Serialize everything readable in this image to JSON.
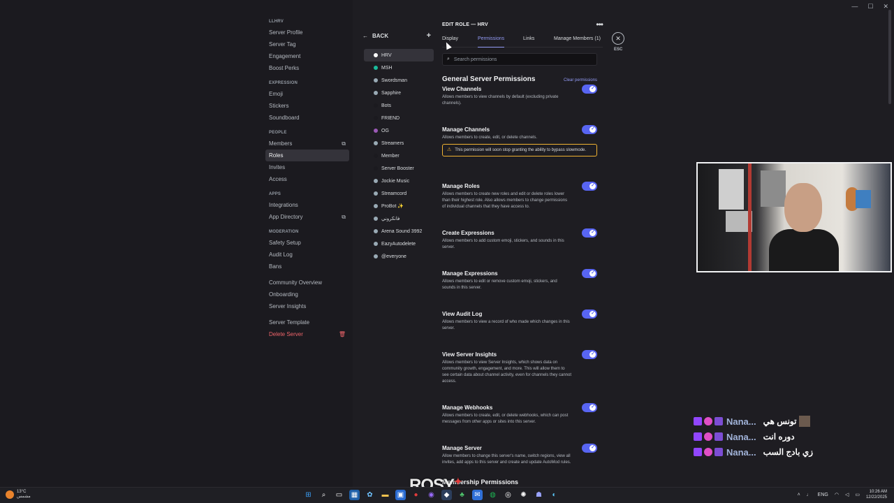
{
  "window": {
    "minimize": "—",
    "maximize": "☐",
    "close": "✕"
  },
  "nav": {
    "server_name": "LLHRV",
    "top_items": [
      "Server Profile",
      "Server Tag",
      "Engagement",
      "Boost Perks"
    ],
    "expression_header": "EXPRESSION",
    "expression_items": [
      "Emoji",
      "Stickers",
      "Soundboard"
    ],
    "people_header": "PEOPLE",
    "people_items": [
      "Members",
      "Roles",
      "Invites",
      "Access"
    ],
    "apps_header": "APPS",
    "apps_items": [
      "Integrations",
      "App Directory"
    ],
    "moderation_header": "MODERATION",
    "moderation_items": [
      "Safety Setup",
      "Audit Log",
      "Bans"
    ],
    "community_items": [
      "Community Overview",
      "Onboarding",
      "Server Insights"
    ],
    "template_item": "Server Template",
    "delete_item": "Delete Server"
  },
  "roles": {
    "back_label": "BACK",
    "add_icon": "+",
    "list": [
      {
        "name": "HRV",
        "color": "#ffffff"
      },
      {
        "name": "MSH",
        "color": "#1abc9c"
      },
      {
        "name": "Swordsman",
        "color": "#99aab5"
      },
      {
        "name": "Sapphire",
        "color": "#99aab5"
      },
      {
        "name": "Bots",
        "color": "#1b1a1f"
      },
      {
        "name": "FRIEND",
        "color": "#1b1a1f"
      },
      {
        "name": "OG",
        "color": "#9b59b6"
      },
      {
        "name": "Streamers",
        "color": "#99aab5"
      },
      {
        "name": "Member",
        "color": "#1b1a1f"
      },
      {
        "name": "Server Booster",
        "color": "#1b1a1f"
      },
      {
        "name": "Jockie Music",
        "color": "#99aab5"
      },
      {
        "name": "Streamcord",
        "color": "#99aab5"
      },
      {
        "name": "ProBot ✨",
        "color": "#99aab5"
      },
      {
        "name": "فانكروني",
        "color": "#99aab5"
      },
      {
        "name": "Arena Sound 3992",
        "color": "#99aab5"
      },
      {
        "name": "EazyAutodelete",
        "color": "#99aab5"
      },
      {
        "name": "@everyone",
        "color": "#99aab5"
      }
    ]
  },
  "main": {
    "title": "EDIT ROLE — HRV",
    "more_icon": "•••",
    "tabs": [
      "Display",
      "Permissions",
      "Links",
      "Manage Members (1)"
    ],
    "search_placeholder": "Search permissions",
    "section_title": "General Server Permissions",
    "clear_label": "Clear permissions",
    "permissions": [
      {
        "name": "View Channels",
        "desc": "Allows members to view channels by default (excluding private channels).",
        "enabled": true
      },
      {
        "name": "Manage Channels",
        "desc": "Allows members to create, edit, or delete channels.",
        "enabled": true,
        "warning": "This permission will soon stop granting the ability to bypass slowmode."
      },
      {
        "name": "Manage Roles",
        "desc": "Allows members to create new roles and edit or delete roles lower than their highest role. Also allows members to change permissions of individual channels that they have access to.",
        "enabled": true
      },
      {
        "name": "Create Expressions",
        "desc": "Allows members to add custom emoji, stickers, and sounds in this server.",
        "enabled": true
      },
      {
        "name": "Manage Expressions",
        "desc": "Allows members to edit or remove custom emoji, stickers, and sounds in this server.",
        "enabled": true
      },
      {
        "name": "View Audit Log",
        "desc": "Allows members to view a record of who made which changes in this server.",
        "enabled": true
      },
      {
        "name": "View Server Insights",
        "desc": "Allows members to view Server Insights, which shows data on community growth, engagement, and more. This will allow them to see certain data about channel activity, even for channels they cannot access.",
        "enabled": true
      },
      {
        "name": "Manage Webhooks",
        "desc": "Allows members to create, edit, or delete webhooks, which can post messages from other apps or sites into this server.",
        "enabled": true
      },
      {
        "name": "Manage Server",
        "desc": "Allow members to change this server's name, switch regions, view all invites, add apps to this server and create and update AutoMod rules.",
        "enabled": true
      }
    ],
    "next_section": "Membership Permissions",
    "close_icon": "✕",
    "esc_label": "ESC"
  },
  "chat": [
    {
      "name": "Nana...",
      "msg": "تونس هي"
    },
    {
      "name": "Nana...",
      "msg": "دوره انت"
    },
    {
      "name": "Nana...",
      "msg": "زي بادج السب"
    }
  ],
  "overlay_text": "ROSY",
  "taskbar": {
    "temp": "13°C",
    "weather_desc": "مشمس",
    "lang": "ENG",
    "time": "10:26 AM",
    "date": "12/22/2025"
  }
}
